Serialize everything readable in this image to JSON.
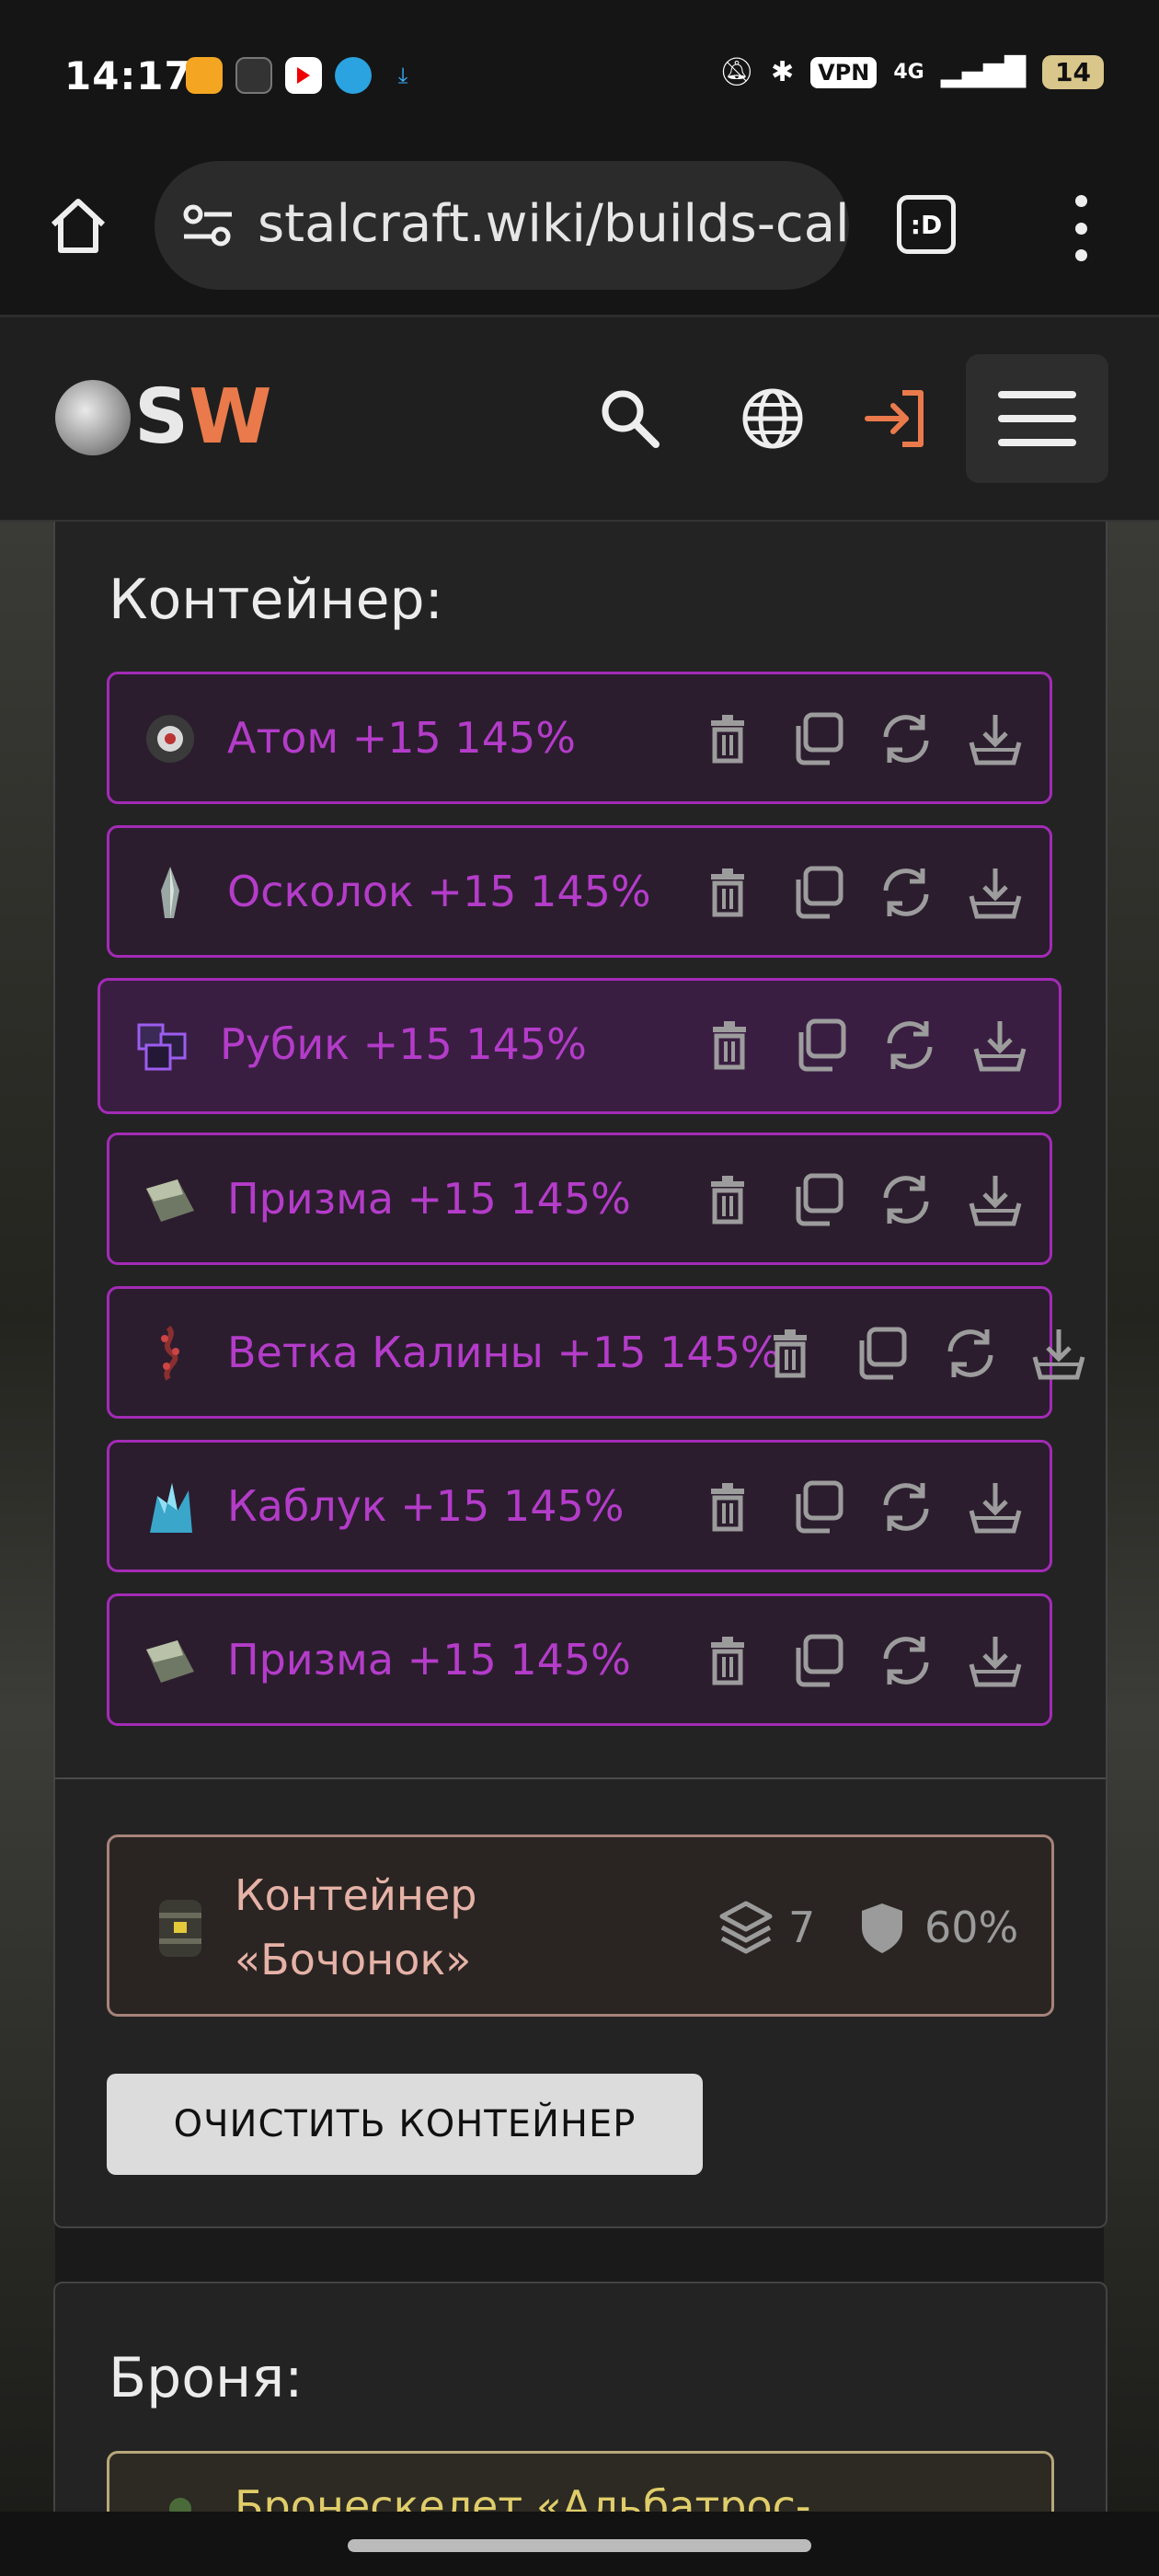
{
  "status_bar": {
    "time": "14:17",
    "vpn": "VPN",
    "network": "4G",
    "battery": "14"
  },
  "browser": {
    "url": "stalcraft.wiki/builds-calc",
    "tabs_label": ":D"
  },
  "site": {
    "logo_s": "S",
    "logo_w": "W"
  },
  "container_section": {
    "title": "Контейнер:",
    "items": [
      {
        "name": "Атом +15 145%",
        "icon": "atom-artifact-icon"
      },
      {
        "name": "Осколок +15 145%",
        "icon": "shard-artifact-icon"
      },
      {
        "name": "Рубик +15 145%",
        "icon": "rubik-artifact-icon"
      },
      {
        "name": "Призма +15 145%",
        "icon": "prism-artifact-icon"
      },
      {
        "name": "Ветка Калины +15 145%",
        "icon": "viburnum-branch-icon"
      },
      {
        "name": "Каблук +15 145%",
        "icon": "heel-artifact-icon"
      },
      {
        "name": "Призма +15 145%",
        "icon": "prism-artifact-icon"
      }
    ],
    "container": {
      "name_line1": "Контейнер",
      "name_line2": "«Бочонок»",
      "slots": "7",
      "protection": "60%"
    },
    "clear_button": "ОЧИСТИТЬ КОНТЕЙНЕР"
  },
  "armor_section": {
    "title": "Броня:",
    "armor_name": "Бронескелет «Альбатрос-"
  },
  "colors": {
    "item_accent": "#a32bb6",
    "item_text": "#b43cc9",
    "container_accent": "#a68379",
    "logo_accent": "#ea7a4b"
  }
}
